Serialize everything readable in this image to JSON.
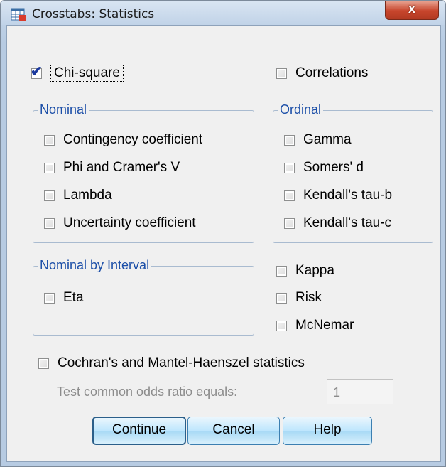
{
  "window": {
    "title": "Crosstabs: Statistics",
    "close_glyph": "x",
    "icon": "spss-table-icon"
  },
  "top": {
    "chi_square": {
      "label": "Chi-square",
      "checked": true
    },
    "correlations": {
      "label": "Correlations",
      "checked": false
    }
  },
  "nominal": {
    "title": "Nominal",
    "items": [
      {
        "label": "Contingency coefficient",
        "checked": false
      },
      {
        "label": "Phi and Cramer's V",
        "checked": false
      },
      {
        "label": "Lambda",
        "checked": false
      },
      {
        "label": "Uncertainty coefficient",
        "checked": false
      }
    ]
  },
  "ordinal": {
    "title": "Ordinal",
    "items": [
      {
        "label": "Gamma",
        "checked": false
      },
      {
        "label": "Somers' d",
        "checked": false
      },
      {
        "label": "Kendall's tau-b",
        "checked": false
      },
      {
        "label": "Kendall's tau-c",
        "checked": false
      }
    ]
  },
  "nominal_by_interval": {
    "title": "Nominal by Interval",
    "items": [
      {
        "label": "Eta",
        "checked": false
      }
    ]
  },
  "other": {
    "items": [
      {
        "label": "Kappa",
        "checked": false
      },
      {
        "label": "Risk",
        "checked": false
      },
      {
        "label": "McNemar",
        "checked": false
      }
    ]
  },
  "cochran": {
    "label": "Cochran's and Mantel-Haenszel statistics",
    "checked": false,
    "odds_label": "Test common odds ratio equals:",
    "odds_value": "1"
  },
  "buttons": {
    "continue": "Continue",
    "cancel": "Cancel",
    "help": "Help"
  },
  "colors": {
    "group_title": "#1c4fa8",
    "checkmark": "#1c3a9e",
    "button_border": "#3c7fb1"
  }
}
